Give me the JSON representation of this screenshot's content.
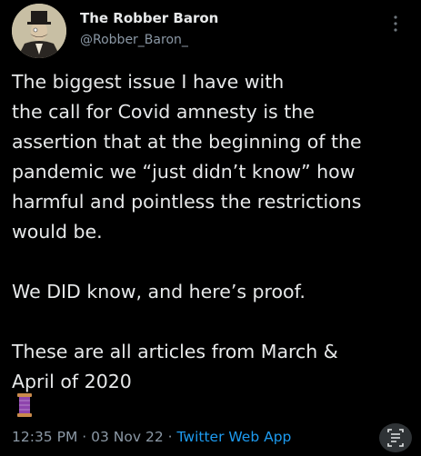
{
  "tweet": {
    "display_name": "The Robber Baron",
    "handle": "@Robber_Baron_",
    "lines": [
      "The biggest issue I have with",
      "the call for Covid amnesty is the",
      "assertion that at the beginning of the",
      "pandemic we “just didn’t know” how",
      "harmful and pointless the restrictions",
      "would be.",
      "",
      "We DID know, and here’s proof.",
      "",
      "These are all articles from March &",
      "April of 2020"
    ],
    "emoji": "spool-of-thread",
    "time": "12:35 PM",
    "date": "03 Nov 22",
    "separator": "·",
    "source": "Twitter Web App"
  },
  "icons": {
    "more": "more-vertical-icon",
    "scan": "scan-text-icon"
  },
  "colors": {
    "background": "#000000",
    "text": "#e7e9ea",
    "secondary": "#8b98a5",
    "link": "#1d9bf0"
  }
}
